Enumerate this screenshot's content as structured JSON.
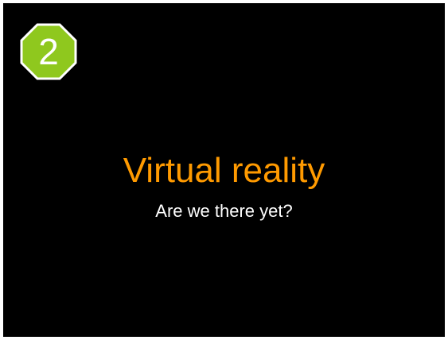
{
  "slide": {
    "number": "2",
    "badge_icon": "octagon-number-badge-icon",
    "title": "Virtual reality",
    "subtitle": "Are we there yet?"
  },
  "colors": {
    "background": "#000000",
    "border": "#ffffff",
    "title": "#ff9a00",
    "subtitle": "#ffffff",
    "badge_fill": "#8fc81e",
    "badge_stroke": "#ffffff"
  }
}
